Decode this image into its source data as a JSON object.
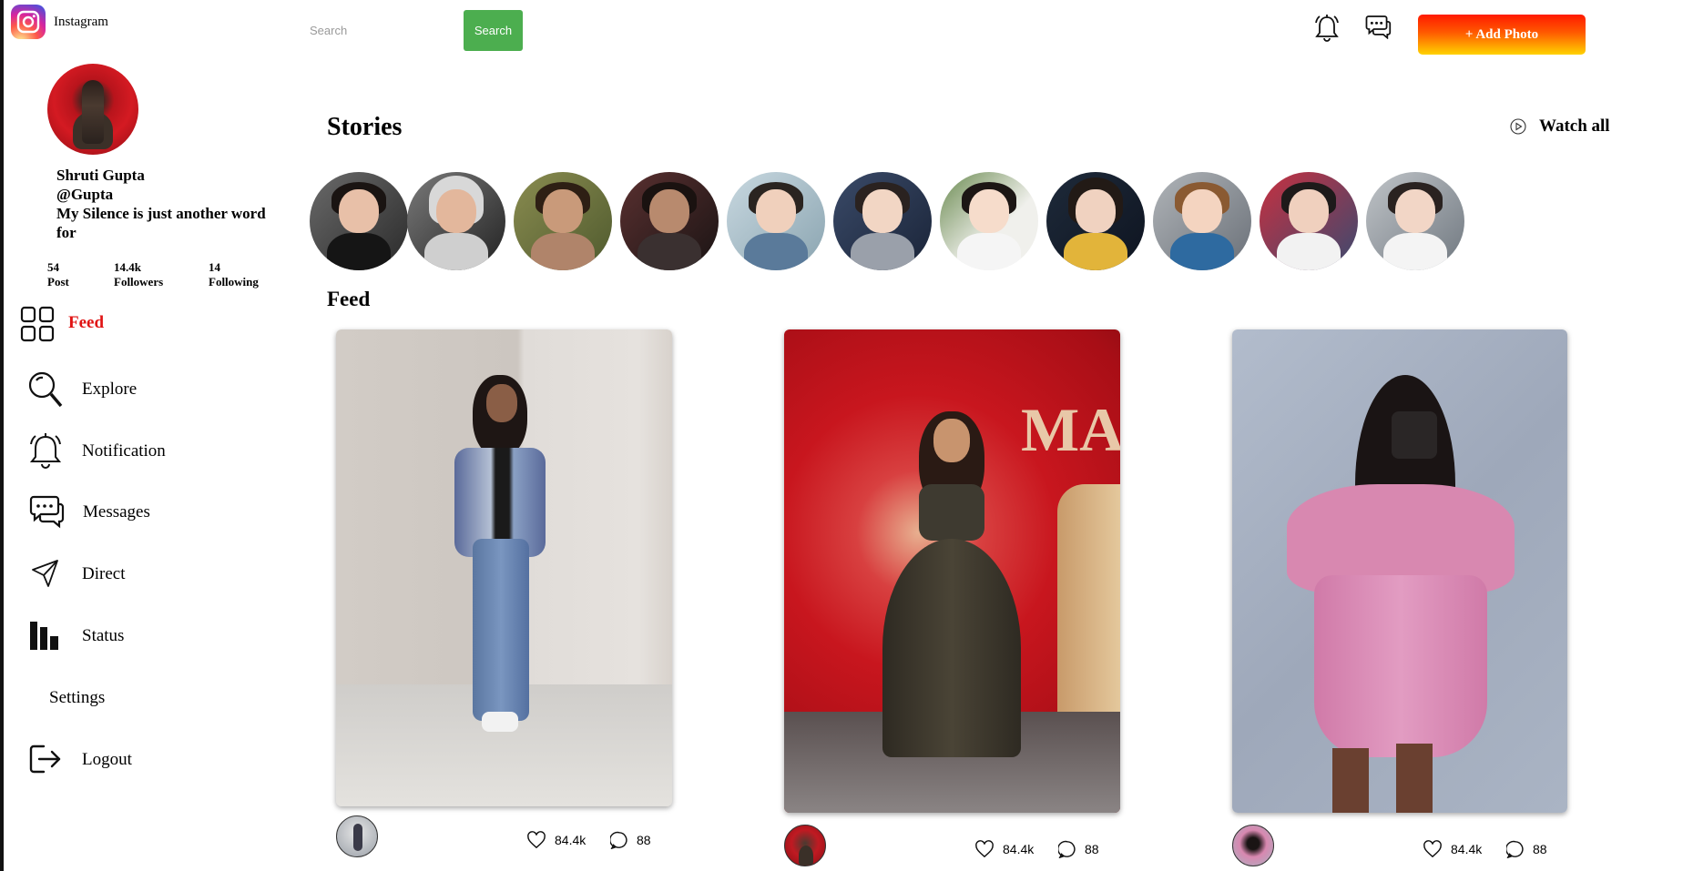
{
  "brand": {
    "name": "Instagram"
  },
  "profile": {
    "name": "Shruti Gupta",
    "handle": "@Gupta",
    "bio": "My Silence is just another word for",
    "stats": [
      {
        "value": "54",
        "label": "Post"
      },
      {
        "value": "14.4k",
        "label": "Followers"
      },
      {
        "value": "14",
        "label": "Following"
      }
    ]
  },
  "menu": [
    {
      "label": "Feed",
      "icon": "grid-icon",
      "active": true
    },
    {
      "label": "Explore",
      "icon": "magnifier-icon"
    },
    {
      "label": "Notification",
      "icon": "bell-icon"
    },
    {
      "label": "Messages",
      "icon": "chat-icon"
    },
    {
      "label": "Direct",
      "icon": "send-icon"
    },
    {
      "label": "Status",
      "icon": "bar-chart-icon"
    },
    {
      "label": "Settings"
    },
    {
      "label": "Logout",
      "icon": "logout-icon"
    }
  ],
  "topbar": {
    "search_placeholder": "Search",
    "search_button": "Search",
    "add_photo": "+ Add Photo"
  },
  "stories": {
    "title": "Stories",
    "watch_all": "Watch all"
  },
  "feed": {
    "title": "Feed",
    "posts": [
      {
        "likes": "84.4k",
        "comments": "88"
      },
      {
        "likes": "84.4k",
        "comments": "88"
      },
      {
        "likes": "84.4k",
        "comments": "88"
      }
    ]
  },
  "colors": {
    "active_menu": "#e01414",
    "search_button": "#4cae4f",
    "add_photo_gradient": [
      "#ff1a00",
      "#ffd200"
    ]
  }
}
